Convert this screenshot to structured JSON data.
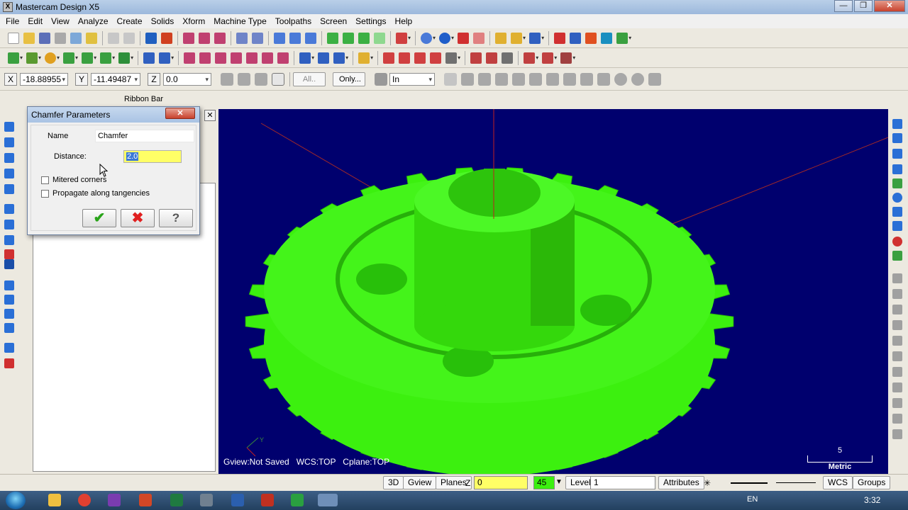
{
  "window": {
    "title": "Mastercam Design X5",
    "app_icon": "X",
    "minimize": "—",
    "maximize": "❐",
    "close": "✕"
  },
  "menu": [
    "File",
    "Edit",
    "View",
    "Analyze",
    "Create",
    "Solids",
    "Xform",
    "Machine Type",
    "Toolpaths",
    "Screen",
    "Settings",
    "Help"
  ],
  "ribbon": {
    "x_label": "X",
    "x_value": "-18.88955",
    "y_label": "Y",
    "y_value": "-11.49487",
    "z_label": "Z",
    "z_value": "0.0",
    "all_button": "All..",
    "only_button": "Only...",
    "mode_value": "In",
    "bar_label": "Ribbon Bar"
  },
  "dialog": {
    "title": "Chamfer Parameters",
    "close_glyph": "✕",
    "name_label": "Name",
    "name_value": "Chamfer",
    "distance_label": "Distance:",
    "distance_value": "2.0",
    "mitered_corners": "Mitered corners",
    "propagate": "Propagate along tangencies",
    "ok_glyph": "✔",
    "cancel_glyph": "✖",
    "help_glyph": "?"
  },
  "ops_panel": {
    "close_glyph": "✕"
  },
  "viewport": {
    "status": "Gview:Not Saved   WCS:TOP   Cplane:TOP",
    "scale_value": "5",
    "scale_unit": "Metric",
    "background": "#00006e",
    "part_color": "#3cf00f",
    "axis_y": "Y"
  },
  "statusbar": {
    "view_3d": "3D",
    "gview": "Gview",
    "planes": "Planes",
    "z_label": "Z",
    "z_value": "0",
    "color_value": "45",
    "level_label": "Level",
    "level_value": "1",
    "attributes": "Attributes",
    "wcs": "WCS",
    "groups": "Groups"
  },
  "taskbar": {
    "lang": "EN",
    "time": "3:32"
  }
}
